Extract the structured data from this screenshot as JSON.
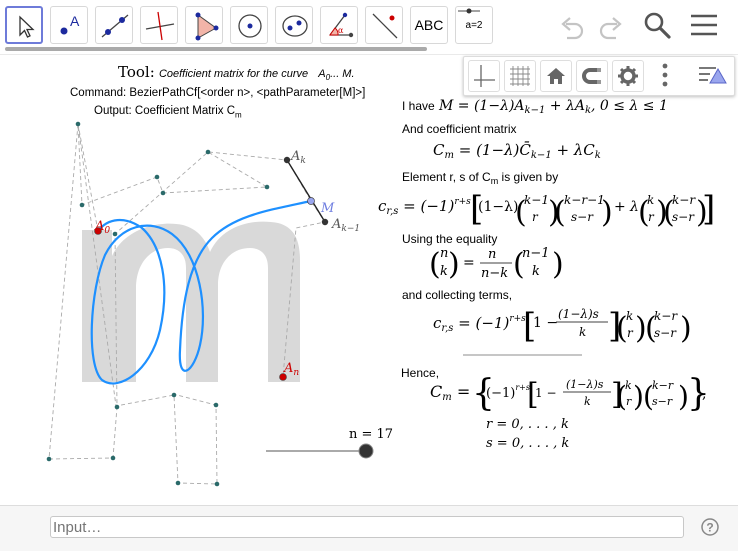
{
  "toolbar": {
    "tools": [
      {
        "name": "move-tool"
      },
      {
        "name": "point-tool",
        "label": "A"
      },
      {
        "name": "line-tool"
      },
      {
        "name": "perpendicular-line-tool"
      },
      {
        "name": "polygon-tool"
      },
      {
        "name": "circle-tool"
      },
      {
        "name": "ellipse-tool"
      },
      {
        "name": "angle-tool"
      },
      {
        "name": "reflect-tool"
      },
      {
        "name": "text-tool",
        "label": "ABC"
      },
      {
        "name": "slider-tool",
        "label": "a=2"
      }
    ],
    "icons": [
      "undo-icon",
      "redo-icon",
      "search-icon",
      "menu-icon"
    ]
  },
  "style_bar": {
    "buttons": [
      "axes-icon",
      "grid-icon",
      "home-icon",
      "snap-icon",
      "gear-icon",
      "more-icon",
      "graphics-style-icon"
    ]
  },
  "canvas": {
    "tool_prefix": "Tool:",
    "tool_desc": "Coefficient matrix for the curve",
    "tool_curve_a": "A",
    "tool_curve_sub": "0",
    "tool_curve_rest": "... M.",
    "command": "Command: BezierPathCf[<order n>, <pathParameter[M]>]",
    "output_prefix": "Output: Coefficient Matrix C",
    "output_sub": "m",
    "labels": {
      "A0": "A",
      "A0_sub": "0",
      "Ak": "A",
      "Ak_sub": "k",
      "M": "M",
      "Ak1": "A",
      "Ak1_sub": "k−1",
      "An": "A",
      "An_sub": "n"
    },
    "slider_label": "n = 17",
    "slider_value": 17,
    "colors": {
      "curve": "#1e90ff",
      "red_point": "#cc0000",
      "letter": "#d9d9d9"
    }
  },
  "text": {
    "i_have": "I have",
    "eq1": "M = (1−λ)A",
    "eq1_sub1": "k−1",
    "eq1_mid": " + λA",
    "eq1_sub2": "k",
    "eq1_tail": ",    0 ≤ λ ≤ 1",
    "and_coeff": "And coefficient matrix",
    "cm_eq": "C",
    "cm_sub": "m",
    "cm_rhs": " = (1−λ)C̄",
    "cm_rhs_sub": "k−1",
    "cm_rhs2": " + λC",
    "cm_rhs2_sub": "k",
    "element_pre": "Element  r, s  of C",
    "element_sub": "m",
    "element_post": "  is given by",
    "crs_eq": "c",
    "crs_sub": "r,s",
    "crs_rhs": " = (−1)",
    "crs_exp": "r+s",
    "binom_kminus1": "k−1",
    "binom_r": "r",
    "binom_kr1": "k−r−1",
    "binom_sr": "s−r",
    "binom_k": "k",
    "binom_kr": "k−r",
    "binom_n": "n",
    "binom_nm1": "n−1",
    "one_minus_lambda": "(1−λ)",
    "lambda": "λ",
    "plus": "+",
    "using": "Using the equality",
    "eq_frac_num": "n",
    "eq_frac_den": "n−k",
    "collecting": "and collecting terms,",
    "one_minus": "1 −",
    "frac2_num": "(1−λ)s",
    "frac2_den": "k",
    "hence": "Hence,",
    "final_cm": "C",
    "final_cm_sub": "m",
    "final_eq": " = ",
    "final_neg": "(−1)",
    "range_r": "r = 0, . . . , k",
    "range_s": "s = 0, . . . , k"
  },
  "input_bar": {
    "placeholder": "Input…"
  }
}
